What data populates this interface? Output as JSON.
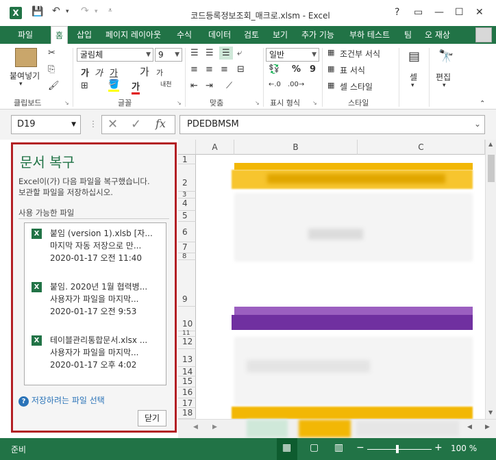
{
  "titlebar": {
    "title": "코드등록정보조회_매크로.xlsm - Excel",
    "help": "?",
    "restore": "▭",
    "minimize": "—",
    "maximize": "☐",
    "close": "✕"
  },
  "tabs": [
    {
      "label": "파일"
    },
    {
      "label": "홈"
    },
    {
      "label": "삽입"
    },
    {
      "label": "페이지 레이아웃"
    },
    {
      "label": "수식"
    },
    {
      "label": "데이터"
    },
    {
      "label": "검토"
    },
    {
      "label": "보기"
    },
    {
      "label": "추가 기능"
    },
    {
      "label": "부하 테스트"
    },
    {
      "label": "팀"
    },
    {
      "label": "오 재상"
    }
  ],
  "ribbon": {
    "paste": "붙여넣기",
    "clipboard": "클립보드",
    "font_name": "굴림체",
    "font_size": "9",
    "font_group": "글꼴",
    "bold": "가",
    "italic": "가",
    "underline": "가",
    "grow": "가",
    "shrink": "가",
    "phonetic": "내천",
    "align_group": "맞춤",
    "number_format": "일반",
    "number_group": "표시 형식",
    "percent": "%",
    "comma": "9",
    "cond_format": "조건부 서식",
    "table_format": "표 서식",
    "cell_style": "셀 스타일",
    "style_group": "스타일",
    "cells": "셀",
    "editing": "편집"
  },
  "formula_bar": {
    "name_box": "D19",
    "fx": "fx",
    "formula": "PDEDBMSM"
  },
  "recovery": {
    "title": "문서 복구",
    "desc1": "Excel이(가) 다음 파일을 복구했습니다.",
    "desc2": "보관할 파일을 저장하십시오.",
    "available": "사용 가능한 파일",
    "files": [
      {
        "name": "붙임 (version 1).xlsb  [자...",
        "detail": "마지막 자동 저장으로 만...",
        "time": "2020-01-17 오전 11:40"
      },
      {
        "name": "붙임. 2020년 1월 협력병...",
        "detail": "사용자가 파일을 마지막...",
        "time": "2020-01-17 오전 9:53"
      },
      {
        "name": "테이블관리통합문서.xlsx ...",
        "detail": "사용자가 파일을 마지막...",
        "time": "2020-01-17 오후 4:02"
      }
    ],
    "help_link": "저장하려는 파일 선택",
    "close": "닫기"
  },
  "grid": {
    "columns": [
      "A",
      "B",
      "C"
    ],
    "rows": [
      "1",
      "2",
      "3",
      "4",
      "5",
      "6",
      "7",
      "8",
      "9",
      "10",
      "11",
      "12",
      "13",
      "14",
      "15",
      "16",
      "17",
      "18"
    ]
  },
  "status": {
    "ready": "준비",
    "zoom": "100 %"
  },
  "colors": {
    "accent": "#217346",
    "pane_border": "#b31f24",
    "header_yellow": "#f2b705",
    "header_purple": "#7030a0"
  }
}
